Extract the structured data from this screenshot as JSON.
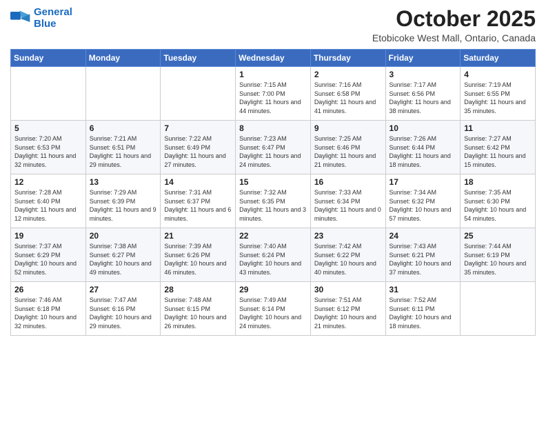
{
  "header": {
    "logo_line1": "General",
    "logo_line2": "Blue",
    "month": "October 2025",
    "location": "Etobicoke West Mall, Ontario, Canada"
  },
  "weekdays": [
    "Sunday",
    "Monday",
    "Tuesday",
    "Wednesday",
    "Thursday",
    "Friday",
    "Saturday"
  ],
  "weeks": [
    [
      {
        "day": "",
        "info": ""
      },
      {
        "day": "",
        "info": ""
      },
      {
        "day": "",
        "info": ""
      },
      {
        "day": "1",
        "info": "Sunrise: 7:15 AM\nSunset: 7:00 PM\nDaylight: 11 hours and 44 minutes."
      },
      {
        "day": "2",
        "info": "Sunrise: 7:16 AM\nSunset: 6:58 PM\nDaylight: 11 hours and 41 minutes."
      },
      {
        "day": "3",
        "info": "Sunrise: 7:17 AM\nSunset: 6:56 PM\nDaylight: 11 hours and 38 minutes."
      },
      {
        "day": "4",
        "info": "Sunrise: 7:19 AM\nSunset: 6:55 PM\nDaylight: 11 hours and 35 minutes."
      }
    ],
    [
      {
        "day": "5",
        "info": "Sunrise: 7:20 AM\nSunset: 6:53 PM\nDaylight: 11 hours and 32 minutes."
      },
      {
        "day": "6",
        "info": "Sunrise: 7:21 AM\nSunset: 6:51 PM\nDaylight: 11 hours and 29 minutes."
      },
      {
        "day": "7",
        "info": "Sunrise: 7:22 AM\nSunset: 6:49 PM\nDaylight: 11 hours and 27 minutes."
      },
      {
        "day": "8",
        "info": "Sunrise: 7:23 AM\nSunset: 6:47 PM\nDaylight: 11 hours and 24 minutes."
      },
      {
        "day": "9",
        "info": "Sunrise: 7:25 AM\nSunset: 6:46 PM\nDaylight: 11 hours and 21 minutes."
      },
      {
        "day": "10",
        "info": "Sunrise: 7:26 AM\nSunset: 6:44 PM\nDaylight: 11 hours and 18 minutes."
      },
      {
        "day": "11",
        "info": "Sunrise: 7:27 AM\nSunset: 6:42 PM\nDaylight: 11 hours and 15 minutes."
      }
    ],
    [
      {
        "day": "12",
        "info": "Sunrise: 7:28 AM\nSunset: 6:40 PM\nDaylight: 11 hours and 12 minutes."
      },
      {
        "day": "13",
        "info": "Sunrise: 7:29 AM\nSunset: 6:39 PM\nDaylight: 11 hours and 9 minutes."
      },
      {
        "day": "14",
        "info": "Sunrise: 7:31 AM\nSunset: 6:37 PM\nDaylight: 11 hours and 6 minutes."
      },
      {
        "day": "15",
        "info": "Sunrise: 7:32 AM\nSunset: 6:35 PM\nDaylight: 11 hours and 3 minutes."
      },
      {
        "day": "16",
        "info": "Sunrise: 7:33 AM\nSunset: 6:34 PM\nDaylight: 11 hours and 0 minutes."
      },
      {
        "day": "17",
        "info": "Sunrise: 7:34 AM\nSunset: 6:32 PM\nDaylight: 10 hours and 57 minutes."
      },
      {
        "day": "18",
        "info": "Sunrise: 7:35 AM\nSunset: 6:30 PM\nDaylight: 10 hours and 54 minutes."
      }
    ],
    [
      {
        "day": "19",
        "info": "Sunrise: 7:37 AM\nSunset: 6:29 PM\nDaylight: 10 hours and 52 minutes."
      },
      {
        "day": "20",
        "info": "Sunrise: 7:38 AM\nSunset: 6:27 PM\nDaylight: 10 hours and 49 minutes."
      },
      {
        "day": "21",
        "info": "Sunrise: 7:39 AM\nSunset: 6:26 PM\nDaylight: 10 hours and 46 minutes."
      },
      {
        "day": "22",
        "info": "Sunrise: 7:40 AM\nSunset: 6:24 PM\nDaylight: 10 hours and 43 minutes."
      },
      {
        "day": "23",
        "info": "Sunrise: 7:42 AM\nSunset: 6:22 PM\nDaylight: 10 hours and 40 minutes."
      },
      {
        "day": "24",
        "info": "Sunrise: 7:43 AM\nSunset: 6:21 PM\nDaylight: 10 hours and 37 minutes."
      },
      {
        "day": "25",
        "info": "Sunrise: 7:44 AM\nSunset: 6:19 PM\nDaylight: 10 hours and 35 minutes."
      }
    ],
    [
      {
        "day": "26",
        "info": "Sunrise: 7:46 AM\nSunset: 6:18 PM\nDaylight: 10 hours and 32 minutes."
      },
      {
        "day": "27",
        "info": "Sunrise: 7:47 AM\nSunset: 6:16 PM\nDaylight: 10 hours and 29 minutes."
      },
      {
        "day": "28",
        "info": "Sunrise: 7:48 AM\nSunset: 6:15 PM\nDaylight: 10 hours and 26 minutes."
      },
      {
        "day": "29",
        "info": "Sunrise: 7:49 AM\nSunset: 6:14 PM\nDaylight: 10 hours and 24 minutes."
      },
      {
        "day": "30",
        "info": "Sunrise: 7:51 AM\nSunset: 6:12 PM\nDaylight: 10 hours and 21 minutes."
      },
      {
        "day": "31",
        "info": "Sunrise: 7:52 AM\nSunset: 6:11 PM\nDaylight: 10 hours and 18 minutes."
      },
      {
        "day": "",
        "info": ""
      }
    ]
  ]
}
